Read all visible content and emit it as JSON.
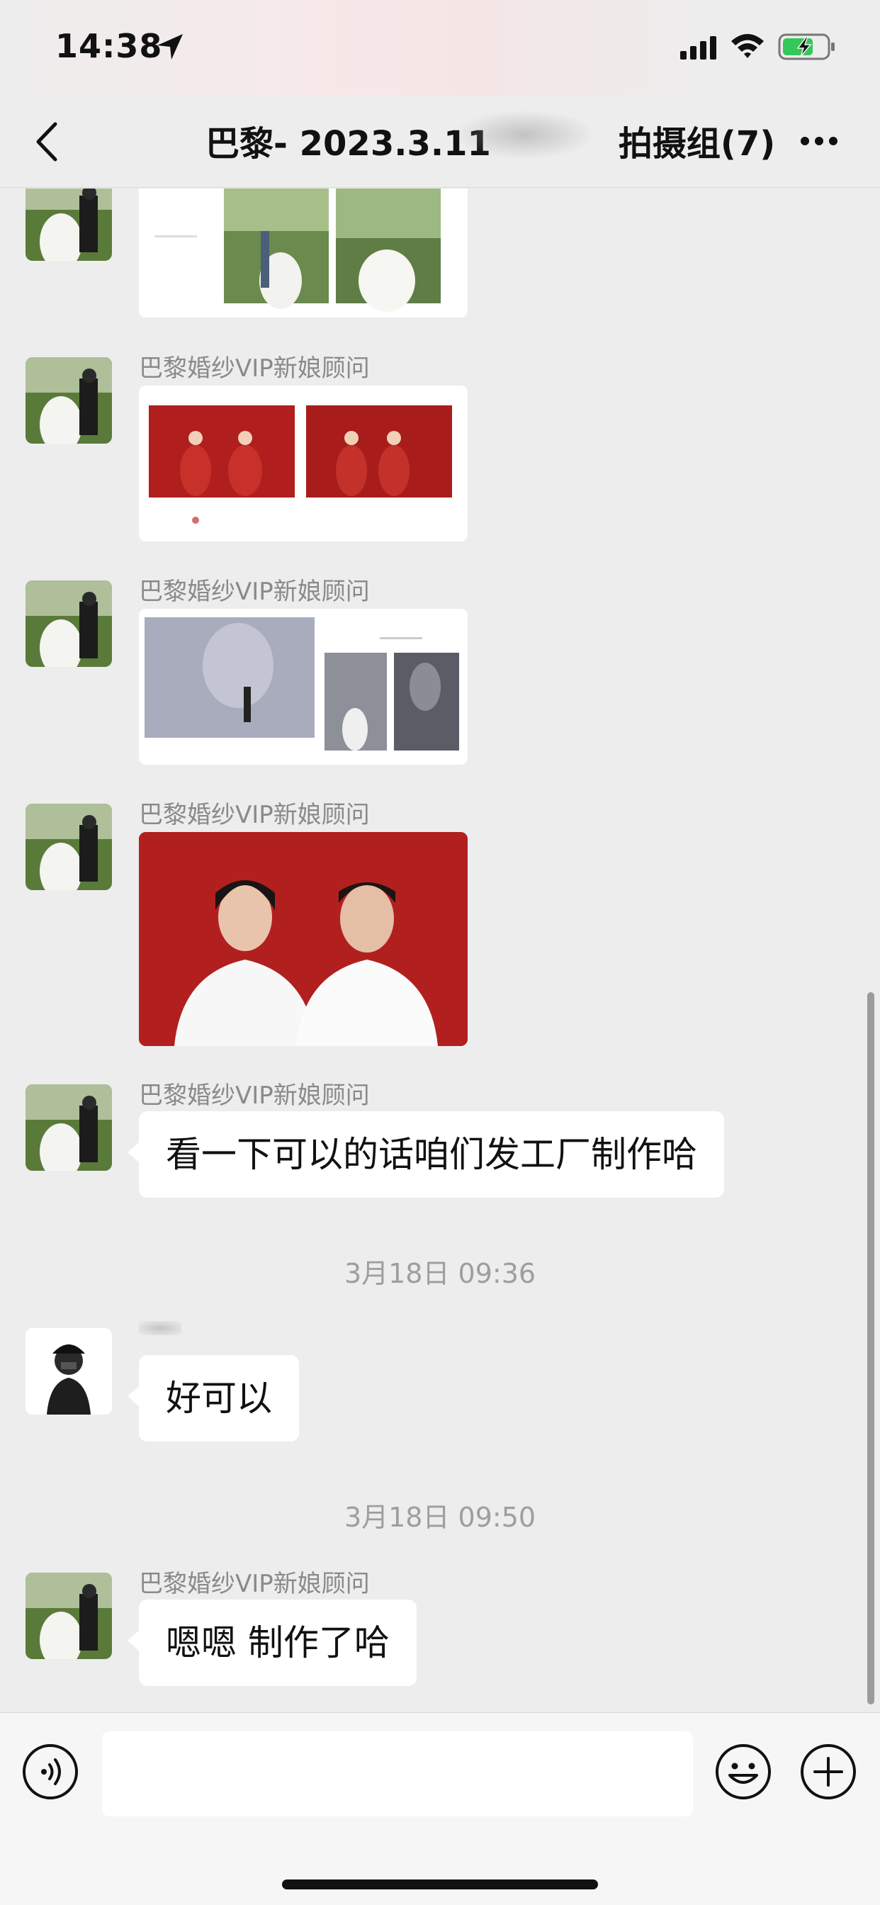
{
  "status_bar": {
    "time": "14:38"
  },
  "nav": {
    "title": "巴黎- 2023.3.11",
    "title_suffix": "拍摄组(7)"
  },
  "messages": [
    {
      "sender": "巴黎婚纱VIP新娘顾问"
    },
    {
      "sender": "巴黎婚纱VIP新娘顾问"
    },
    {
      "sender": "巴黎婚纱VIP新娘顾问"
    },
    {
      "sender": "巴黎婚纱VIP新娘顾问",
      "text": "看一下可以的话咱们发工厂制作哈"
    },
    {
      "text": "好可以"
    },
    {
      "sender": "巴黎婚纱VIP新娘顾问",
      "text": "嗯嗯 制作了哈"
    }
  ],
  "timestamps": [
    "3月18日 09:36",
    "3月18日 09:50"
  ],
  "input": {
    "value": "",
    "placeholder": ""
  },
  "colors": {
    "background": "#ededed",
    "bubble": "#ffffff",
    "accent_red": "#b1201f",
    "battery_green": "#34c759"
  },
  "icons": [
    "location-arrow-icon",
    "signal-icon",
    "wifi-icon",
    "battery-icon",
    "back-icon",
    "more-icon",
    "voice-icon",
    "emoji-icon",
    "plus-icon"
  ]
}
